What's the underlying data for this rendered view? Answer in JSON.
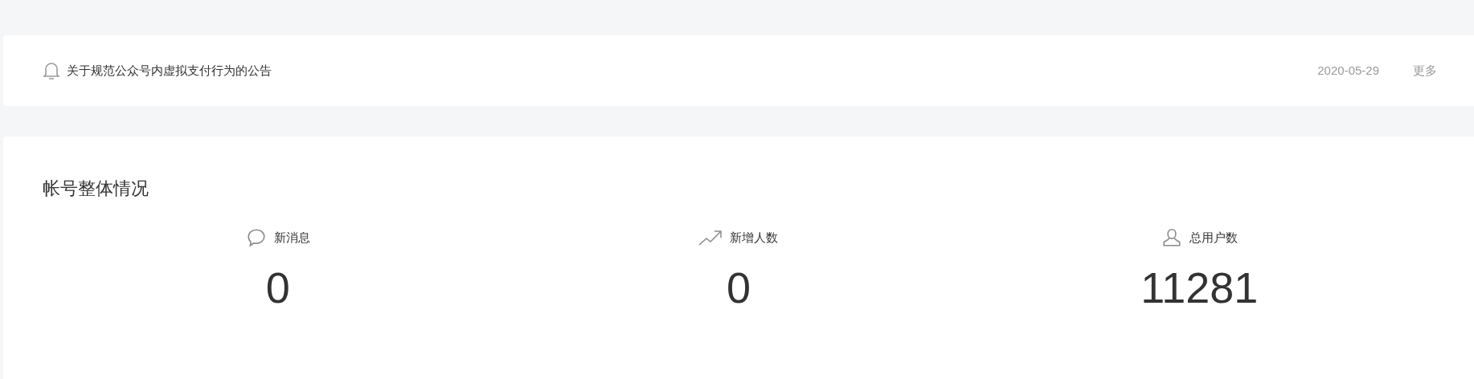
{
  "notice": {
    "title": "关于规范公众号内虚拟支付行为的公告",
    "date": "2020-05-29",
    "more": "更多"
  },
  "overview": {
    "title": "帐号整体情况",
    "stats": [
      {
        "kind": "message",
        "label": "新消息",
        "value": "0"
      },
      {
        "kind": "growth",
        "label": "新增人数",
        "value": "0"
      },
      {
        "kind": "user",
        "label": "总用户数",
        "value": "11281"
      }
    ]
  }
}
